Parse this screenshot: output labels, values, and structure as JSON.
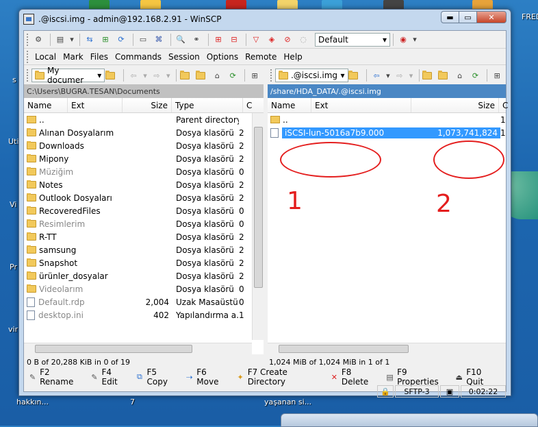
{
  "desktop": {
    "labels": [
      "FRED",
      "hakkın...",
      "7",
      "yaşanan si...",
      "s",
      "Uti",
      "Vi",
      "Pr",
      "vir"
    ]
  },
  "window": {
    "title": ".@iscsi.img - admin@192.168.2.91 - WinSCP",
    "buttons": {
      "minimize": "▬",
      "maximize": "▭",
      "close": "✕"
    }
  },
  "toolbar": {
    "session_combo": "Default"
  },
  "menu": [
    "Local",
    "Mark",
    "Files",
    "Commands",
    "Session",
    "Options",
    "Remote",
    "Help"
  ],
  "left_panel": {
    "location_combo": "My documer",
    "path": "C:\\Users\\BUGRA.TESAN\\Documents",
    "columns": [
      "Name",
      "Ext",
      "Size",
      "Type",
      "C"
    ],
    "rows": [
      {
        "name": "..",
        "size": "",
        "type": "Parent directory",
        "more": "",
        "icon": "up",
        "dim": false
      },
      {
        "name": "Alınan Dosyalarım",
        "size": "",
        "type": "Dosya klasörü",
        "more": "2",
        "icon": "folder",
        "dim": false
      },
      {
        "name": "Downloads",
        "size": "",
        "type": "Dosya klasörü",
        "more": "2",
        "icon": "folder",
        "dim": false
      },
      {
        "name": "Mipony",
        "size": "",
        "type": "Dosya klasörü",
        "more": "2",
        "icon": "folder",
        "dim": false
      },
      {
        "name": "Müziğim",
        "size": "",
        "type": "Dosya klasörü",
        "more": "0",
        "icon": "folder",
        "dim": true
      },
      {
        "name": "Notes",
        "size": "",
        "type": "Dosya klasörü",
        "more": "2",
        "icon": "folder",
        "dim": false
      },
      {
        "name": "Outlook Dosyaları",
        "size": "",
        "type": "Dosya klasörü",
        "more": "2",
        "icon": "folder",
        "dim": false
      },
      {
        "name": "RecoveredFiles",
        "size": "",
        "type": "Dosya klasörü",
        "more": "0",
        "icon": "folder",
        "dim": false
      },
      {
        "name": "Resimlerim",
        "size": "",
        "type": "Dosya klasörü",
        "more": "0",
        "icon": "folder",
        "dim": true
      },
      {
        "name": "R-TT",
        "size": "",
        "type": "Dosya klasörü",
        "more": "2",
        "icon": "folder",
        "dim": false
      },
      {
        "name": "samsung",
        "size": "",
        "type": "Dosya klasörü",
        "more": "2",
        "icon": "folder",
        "dim": false
      },
      {
        "name": "Snapshot",
        "size": "",
        "type": "Dosya klasörü",
        "more": "2",
        "icon": "folder",
        "dim": false
      },
      {
        "name": "ürünler_dosyalar",
        "size": "",
        "type": "Dosya klasörü",
        "more": "2",
        "icon": "folder",
        "dim": false
      },
      {
        "name": "Videolarım",
        "size": "",
        "type": "Dosya klasörü",
        "more": "0",
        "icon": "folder",
        "dim": true
      },
      {
        "name": "Default.rdp",
        "size": "2,004",
        "type": "Uzak Masaüstü...",
        "more": "0",
        "icon": "file",
        "dim": true
      },
      {
        "name": "desktop.ini",
        "size": "402",
        "type": "Yapılandırma a...",
        "more": "1",
        "icon": "file",
        "dim": true
      }
    ],
    "status": "0 B of 20,288 KiB in 0 of 19"
  },
  "right_panel": {
    "location_combo": ".@iscsi.img",
    "path": "/share/HDA_DATA/.@iscsi.img",
    "columns": [
      "Name",
      "Ext",
      "Size",
      "C"
    ],
    "rows": [
      {
        "name": "..",
        "size": "",
        "more": "1",
        "icon": "up",
        "selected": false
      },
      {
        "name": "iSCSI-lun-5016a7b9.000",
        "size": "1,073,741,824",
        "more": "1",
        "icon": "file",
        "selected": true
      }
    ],
    "status": "1,024 MiB of 1,024 MiB in 1 of 1"
  },
  "annotations": {
    "one": "1",
    "two": "2"
  },
  "fkeys": [
    {
      "label": "F2 Rename",
      "icon": "rename-icon"
    },
    {
      "label": "F4 Edit",
      "icon": "edit-icon"
    },
    {
      "label": "F5 Copy",
      "icon": "copy-icon"
    },
    {
      "label": "F6 Move",
      "icon": "move-icon"
    },
    {
      "label": "F7 Create Directory",
      "icon": "create-directory-icon"
    },
    {
      "label": "F8 Delete",
      "icon": "delete-icon"
    },
    {
      "label": "F9 Properties",
      "icon": "properties-icon"
    },
    {
      "label": "F10 Quit",
      "icon": "quit-icon"
    }
  ],
  "bottom_status": {
    "protocol": "SFTP-3",
    "elapsed": "0:02:22"
  }
}
